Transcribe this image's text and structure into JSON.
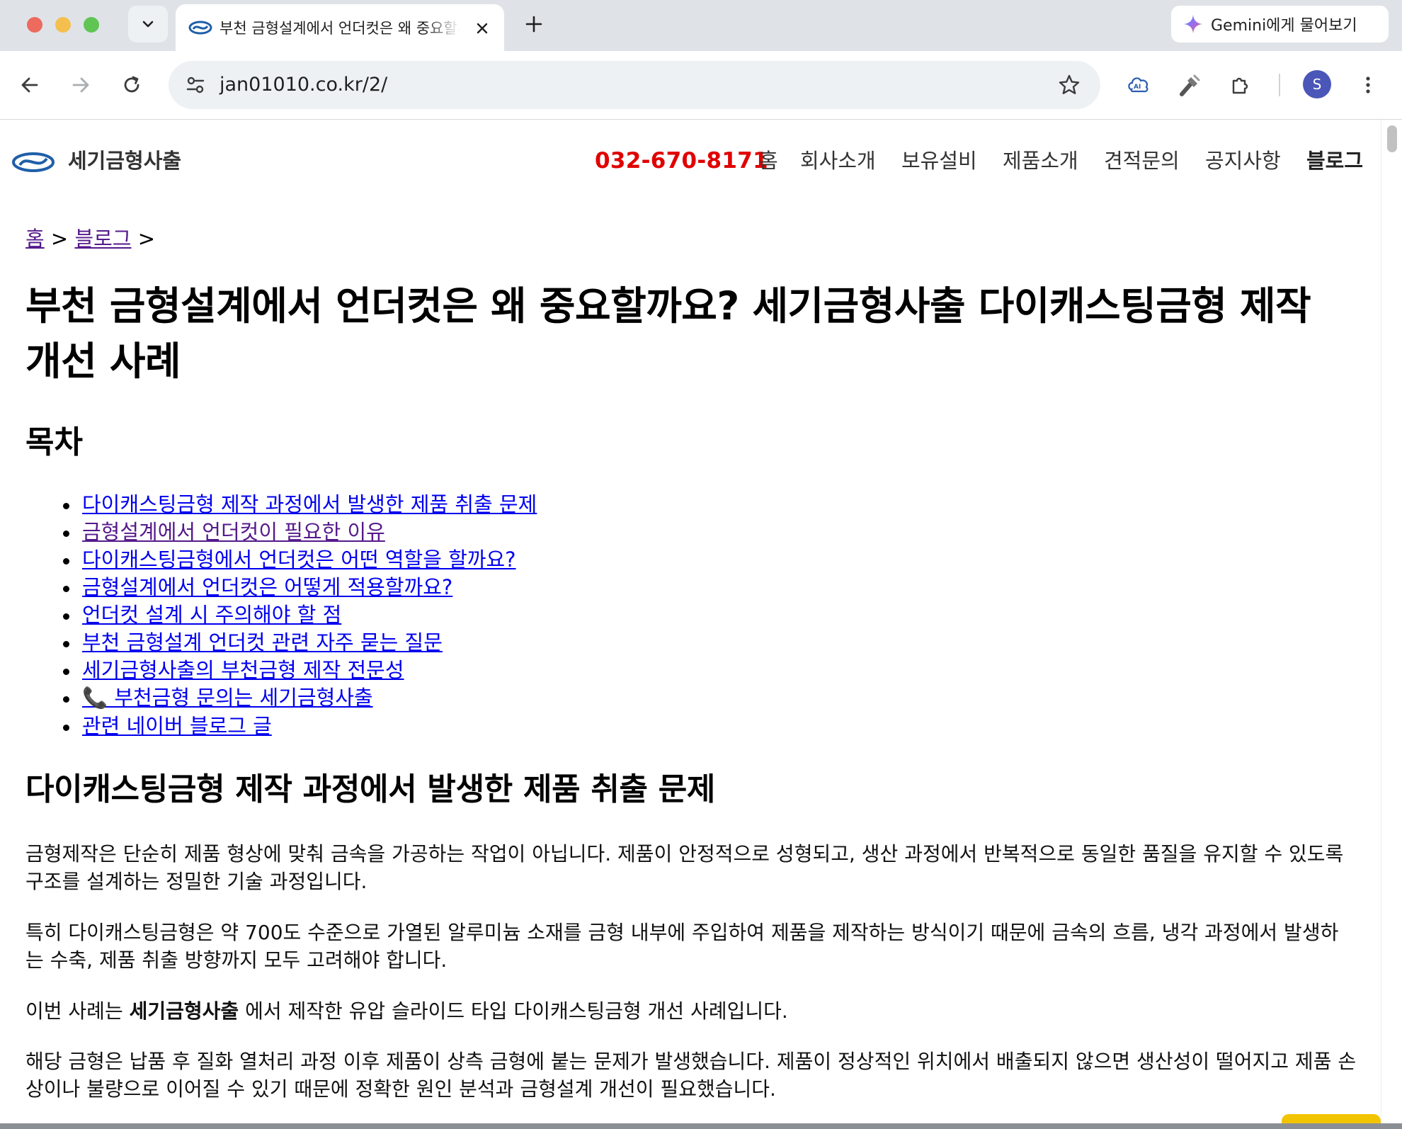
{
  "browser": {
    "tab": {
      "title": "부천 금형설계에서 언더컷은 왜 중요할까요? 세기금형사출 다이캐스팅금형 제작 개선 사례"
    },
    "gemini_label": "Gemini에게 물어보기",
    "address": "jan01010.co.kr/2/",
    "profile_initial": "S"
  },
  "site": {
    "name": "세기금형사출",
    "phone": "032-670-8171",
    "nav": [
      "홈",
      "회사소개",
      "보유설비",
      "제품소개",
      "견적문의",
      "공지사항",
      "블로그"
    ]
  },
  "breadcrumb": {
    "home": "홈",
    "sep1": ">",
    "blog": "블로그",
    "sep2": ">"
  },
  "article": {
    "title": "부천 금형설계에서 언더컷은 왜 중요할까요? 세기금형사출 다이캐스팅금형 제작 개선 사례",
    "toc_heading": "목차",
    "toc": [
      "다이캐스팅금형 제작 과정에서 발생한 제품 취출 문제",
      "금형설계에서 언더컷이 필요한 이유",
      "다이캐스팅금형에서 언더컷은 어떤 역할을 할까요?",
      "금형설계에서 언더컷은 어떻게 적용할까요?",
      "언더컷 설계 시 주의해야 할 점",
      "부천 금형설계 언더컷 관련 자주 묻는 질문",
      "세기금형사출의 부천금형 제작 전문성",
      "📞 부천금형 문의는 세기금형사출",
      "관련 네이버 블로그 글"
    ],
    "section_heading": "다이캐스팅금형 제작 과정에서 발생한 제품 취출 문제",
    "paragraphs": {
      "p1": "금형제작은 단순히 제품 형상에 맞춰 금속을 가공하는 작업이 아닙니다. 제품이 안정적으로 성형되고, 생산 과정에서 반복적으로 동일한 품질을 유지할 수 있도록 구조를 설계하는 정밀한 기술 과정입니다.",
      "p2": "특히 다이캐스팅금형은 약 700도 수준으로 가열된 알루미늄 소재를 금형 내부에 주입하여 제품을 제작하는 방식이기 때문에 금속의 흐름, 냉각 과정에서 발생하는 수축, 제품 취출 방향까지 모두 고려해야 합니다.",
      "p3_before": "이번 사례는 ",
      "p3_bold": "세기금형사출",
      "p3_after": " 에서 제작한 유압 슬라이드 타입 다이캐스팅금형 개선 사례입니다.",
      "p4": "해당 금형은 납품 후 질화 열처리 과정 이후 제품이 상측 금형에 붙는 문제가 발생했습니다. 제품이 정상적인 위치에서 배출되지 않으면 생산성이 떨어지고 제품 손상이나 불량으로 이어질 수 있기 때문에 정확한 원인 분석과 금형설계 개선이 필요했습니다."
    }
  },
  "colors": {
    "phone": "#e00000",
    "link": "#0000ee",
    "visited_link": "#551a8b",
    "logo_blue": "#1f5fa8"
  }
}
